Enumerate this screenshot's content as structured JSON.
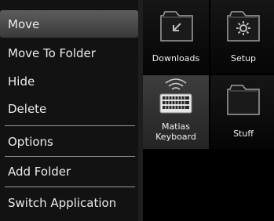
{
  "menu": {
    "items": [
      {
        "label": "Move",
        "selected": true
      },
      {
        "label": "Move To Folder",
        "selected": false
      },
      {
        "label": "Hide",
        "selected": false
      },
      {
        "label": "Delete",
        "selected": false
      },
      {
        "label": "Options",
        "selected": false
      },
      {
        "label": "Add Folder",
        "selected": false
      },
      {
        "label": "Switch Application",
        "selected": false
      }
    ]
  },
  "grid": {
    "tiles": [
      {
        "label": "Downloads",
        "icon": "downloads-folder-icon"
      },
      {
        "label": "Setup",
        "icon": "setup-folder-icon"
      },
      {
        "label": "Matias Keyboard",
        "label_line1": "Matias",
        "label_line2": "Keyboard",
        "icon": "wireless-keyboard-icon",
        "selected": true
      },
      {
        "label": "Stuff",
        "icon": "folder-icon"
      }
    ]
  },
  "colors": {
    "background": "#000000",
    "menu_background": "#121212",
    "selected_item": "#4a4a4a",
    "text": "#ececec",
    "folder_fill": "#1a1a1a",
    "folder_stroke": "#9a9a9a"
  }
}
